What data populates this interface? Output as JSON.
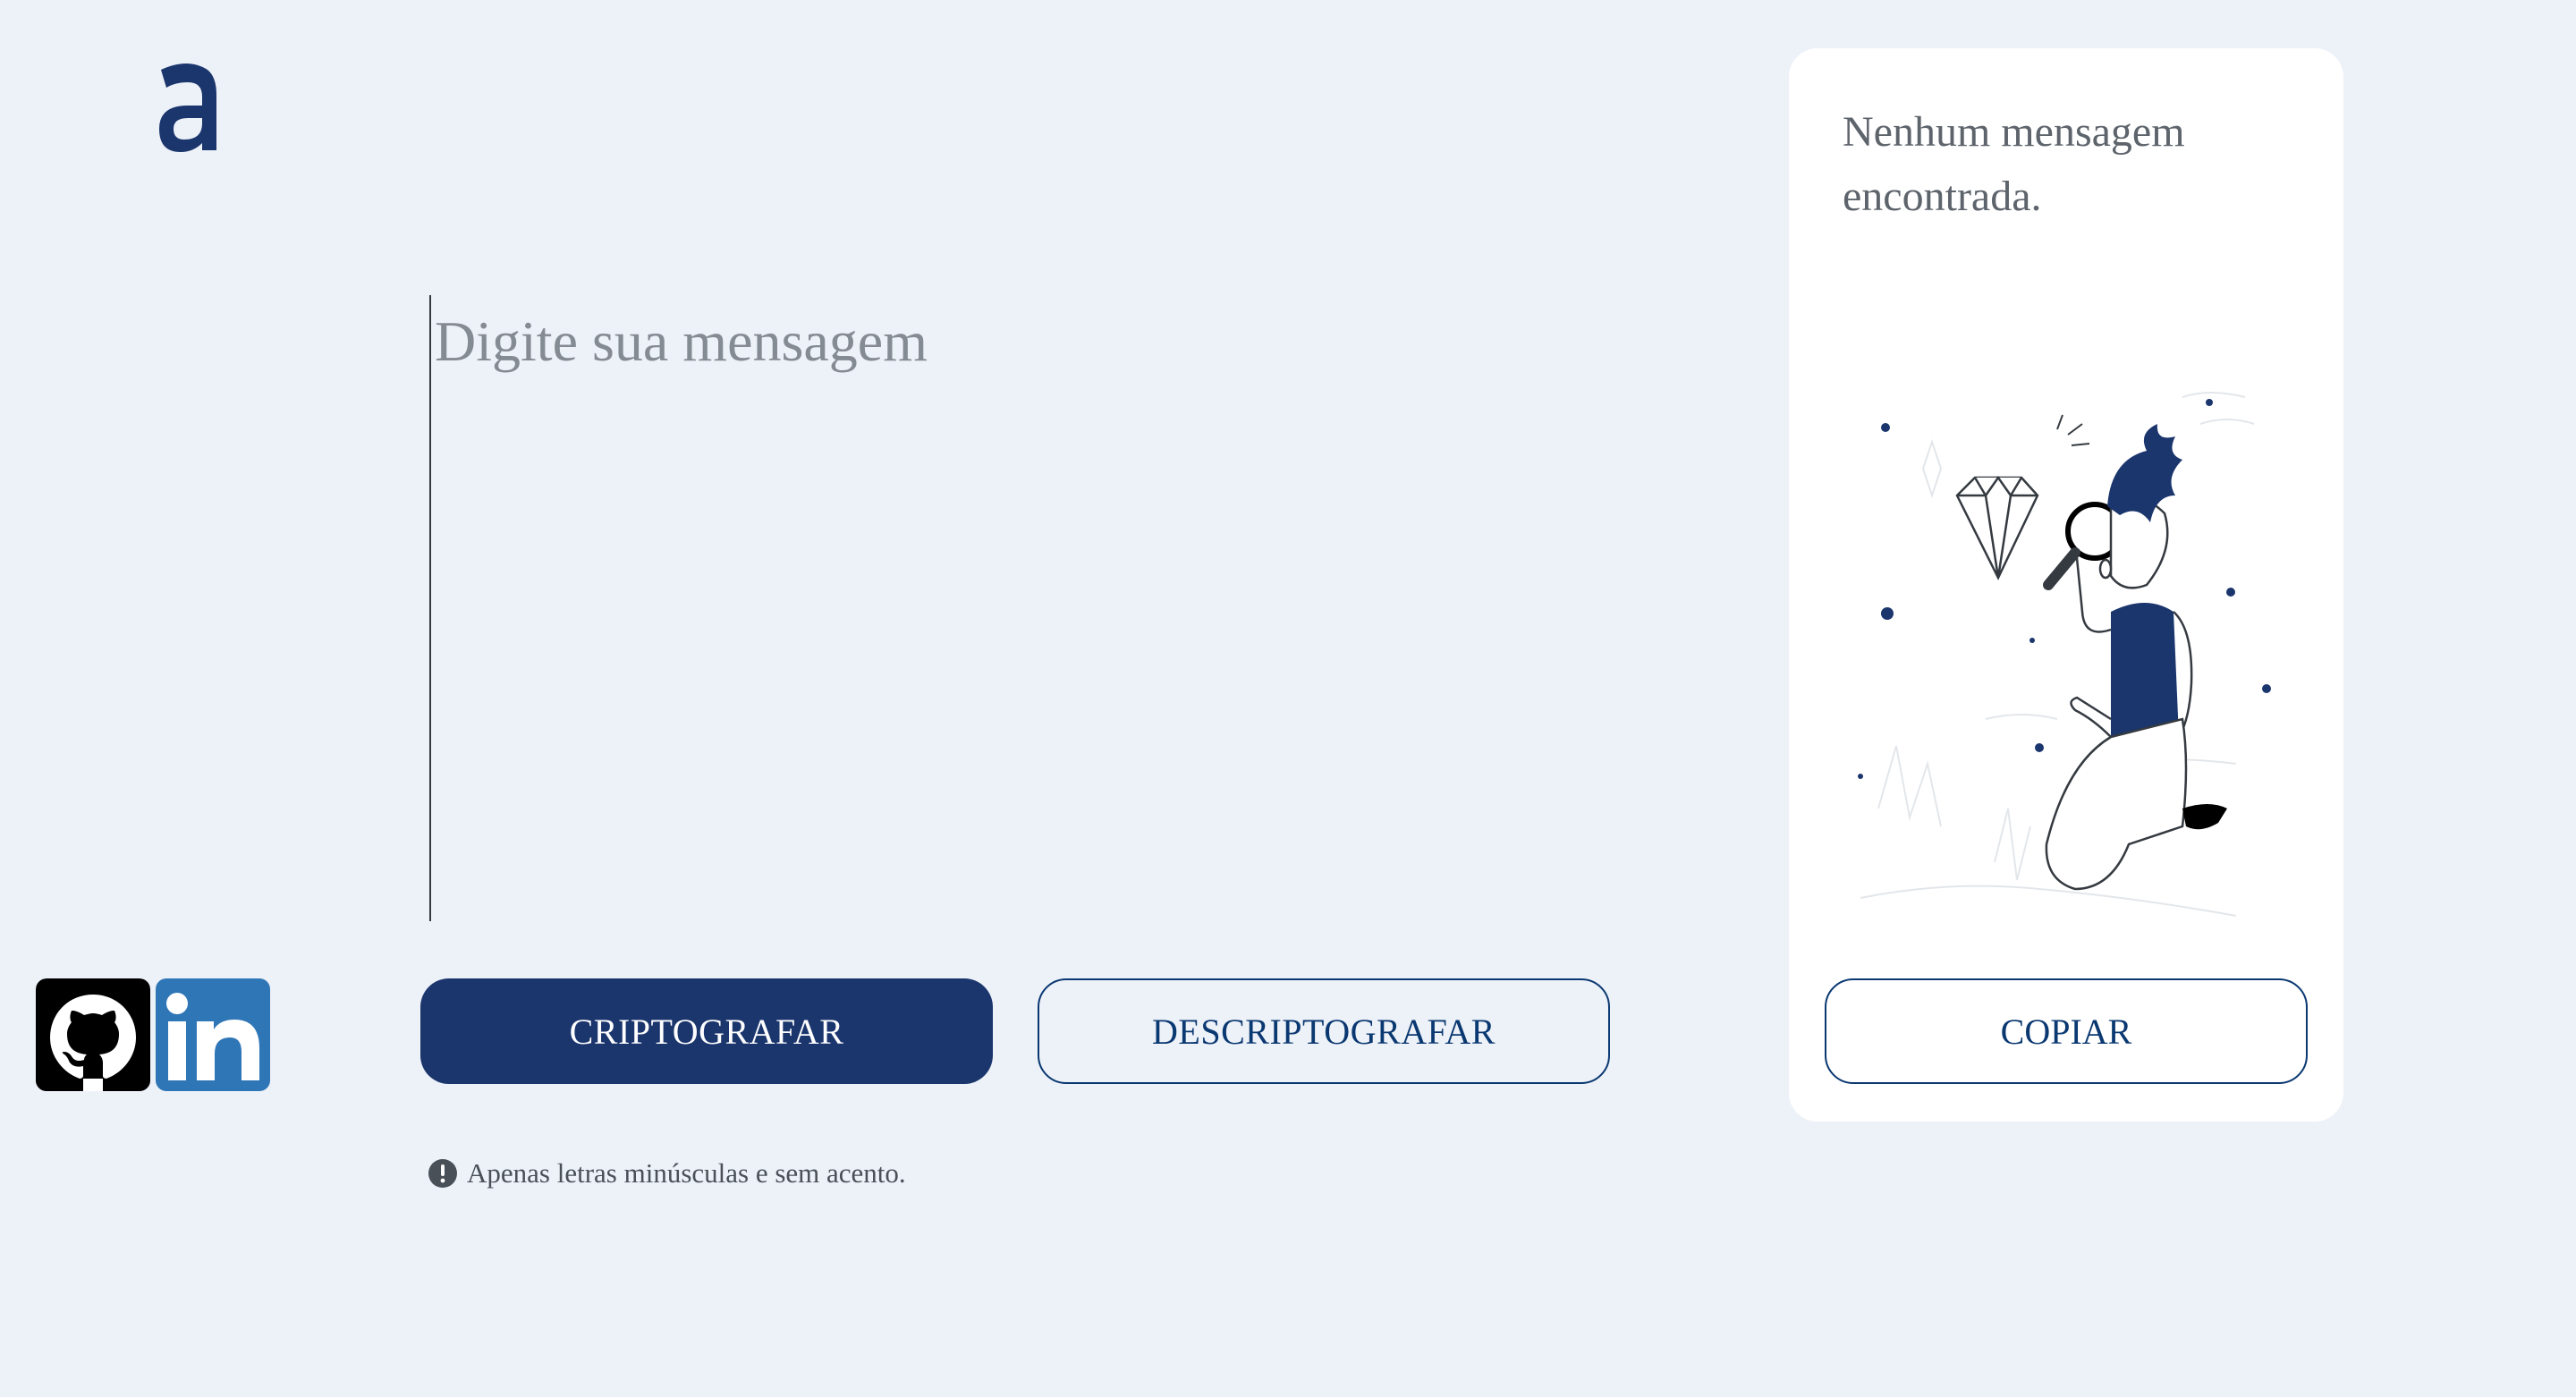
{
  "input": {
    "placeholder": "Digite sua mensagem",
    "value": ""
  },
  "buttons": {
    "encrypt_label": "CRIPTOGRAFAR",
    "decrypt_label": "DESCRIPTOGRAFAR",
    "copy_label": "COPIAR"
  },
  "hint": {
    "icon": "exclamation-circle-icon",
    "text": "Apenas letras minúsculas e sem acento."
  },
  "output_panel": {
    "empty_message": "Nenhum mensagem encontrada."
  },
  "social": {
    "icons": [
      "github-icon",
      "linkedin-icon"
    ]
  },
  "colors": {
    "background": "#edf1f8",
    "primary": "#1b356d",
    "secondary_border": "#0a3871",
    "panel": "#ffffff"
  }
}
